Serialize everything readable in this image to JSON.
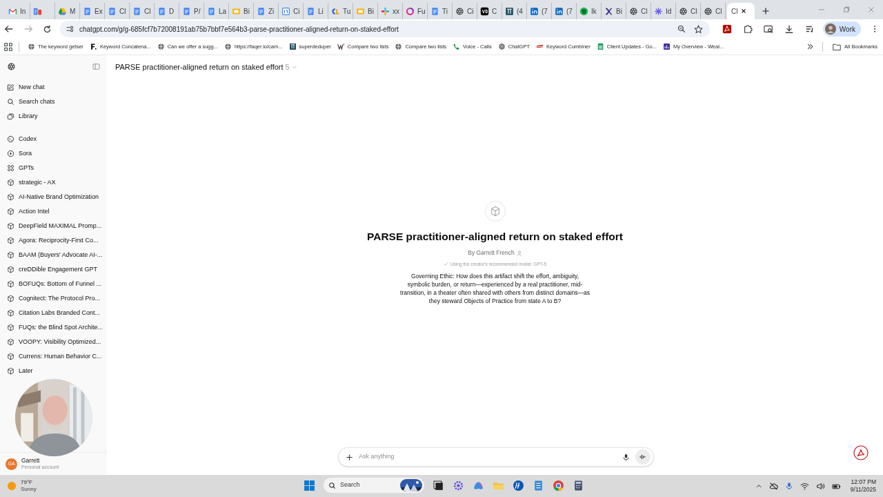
{
  "tabs": [
    {
      "kind": "gmail",
      "label": "In",
      "selected": false
    },
    {
      "kind": "docs-pair",
      "selected": false
    },
    {
      "kind": "drive",
      "label": "M",
      "selected": false
    },
    {
      "kind": "docs",
      "label": "Ex",
      "selected": false
    },
    {
      "kind": "docs",
      "label": "Cl",
      "selected": false
    },
    {
      "kind": "docs",
      "label": "Cl",
      "selected": false
    },
    {
      "kind": "docs",
      "label": "D",
      "selected": false
    },
    {
      "kind": "docs",
      "label": "P/",
      "selected": false
    },
    {
      "kind": "docs",
      "label": "La",
      "selected": false
    },
    {
      "kind": "slides",
      "label": "Bi",
      "selected": false
    },
    {
      "kind": "docs",
      "label": "Zi",
      "selected": false
    },
    {
      "kind": "calendar",
      "label": "Ci",
      "selected": false
    },
    {
      "kind": "docs",
      "label": "Li",
      "selected": false
    },
    {
      "kind": "cl",
      "label": "Tu",
      "selected": false
    },
    {
      "kind": "slides",
      "label": "Bi",
      "selected": false
    },
    {
      "kind": "slack",
      "label": "xx",
      "selected": false
    },
    {
      "kind": "ring",
      "label": "Fu",
      "selected": false
    },
    {
      "kind": "docs",
      "label": "Ti",
      "selected": false
    },
    {
      "kind": "openai",
      "label": "Ci",
      "selected": false
    },
    {
      "kind": "vo",
      "label": "C",
      "selected": false
    },
    {
      "kind": "tt",
      "label": "(4",
      "selected": false
    },
    {
      "kind": "linkedin",
      "label": "(7",
      "selected": false
    },
    {
      "kind": "linkedin",
      "label": "(7",
      "selected": false
    },
    {
      "kind": "spotify",
      "label": "Ik",
      "selected": false
    },
    {
      "kind": "x",
      "label": "Bi",
      "selected": false
    },
    {
      "kind": "openai",
      "label": "Cl",
      "selected": false
    },
    {
      "kind": "star",
      "label": "Id",
      "selected": false
    },
    {
      "kind": "openai",
      "label": "Cl",
      "selected": false
    },
    {
      "kind": "openai",
      "label": "Cl",
      "selected": false
    },
    {
      "kind": "plain",
      "label": "Cl",
      "selected": true
    }
  ],
  "address_bar": {
    "url": "chatgpt.com/g/g-685fcf7b72008191ab75b7bbf7e564b3-parse-practitioner-aligned-return-on-staked-effort"
  },
  "profile": {
    "label": "Work"
  },
  "bookmarks": [
    {
      "kind": "globe",
      "label": "The keyword getser"
    },
    {
      "kind": "f",
      "label": "Keyword Concatena..."
    },
    {
      "kind": "globe",
      "label": "Can we offer a sugg..."
    },
    {
      "kind": "globe",
      "label": "https://faqer.io/cam..."
    },
    {
      "kind": "tt",
      "label": "superdeduper"
    },
    {
      "kind": "w",
      "label": "Compare two lists"
    },
    {
      "kind": "globe",
      "label": "Compare two lists"
    },
    {
      "kind": "phone",
      "label": "Voice - Calls"
    },
    {
      "kind": "openai",
      "label": "ChatGPT"
    },
    {
      "kind": "flag",
      "label": "Keyword Combiner"
    },
    {
      "kind": "sheets",
      "label": "Client Updates - Go..."
    },
    {
      "kind": "chart",
      "label": "My Overview - Weal..."
    }
  ],
  "all_bookmarks": "All Bookmarks",
  "sidebar": {
    "nav": [
      {
        "kind": "edit",
        "label": "New chat"
      },
      {
        "kind": "search",
        "label": "Search chats"
      },
      {
        "kind": "library",
        "label": "Library"
      }
    ],
    "apps": [
      {
        "kind": "codex",
        "label": "Codex"
      },
      {
        "kind": "play",
        "label": "Sora"
      },
      {
        "kind": "grid",
        "label": "GPTs"
      }
    ],
    "gpts": [
      "strategic - AX",
      "AI-Native Brand Optimization",
      "Action Intel",
      "DeepField MAXIMAL Promp...",
      "Agora: Reciprocity-First Co...",
      "BAAM (Buyers' Advocate AI-...",
      "creDDible Engagement GPT",
      "BOFUQs: Bottom of Funnel ...",
      "Cognitect: The Protocol Pro...",
      "Citation Labs Branded Cont...",
      "FUQs: the Blind Spot Archite...",
      "VOOPY: Visibility Optimized...",
      "Currens: Human Behavior C...",
      "Later"
    ],
    "account": {
      "initials": "GA",
      "name": "Garrett",
      "plan": "Personal account"
    }
  },
  "header": {
    "title": "PARSE practitioner-aligned return on staked effort",
    "version": "5"
  },
  "gpt": {
    "title": "PARSE practitioner-aligned return on staked effort",
    "author": "By Garrett French",
    "model_note": "Using the creator's recommended model: GPT-5",
    "description": "Governing Ethic: How does this artifact shift the effort, ambiguity, symbolic burden, or return—experienced by a real practitioner, mid-transition, in a theater often shared with others from distinct domains—as they steward Objects of Practice from state A to B?"
  },
  "composer": {
    "placeholder": "Ask anything"
  },
  "taskbar": {
    "weather": {
      "temp": "79°F",
      "condition": "Sunny"
    },
    "search": {
      "placeholder": "Search"
    },
    "apps": [
      {
        "kind": "squares"
      },
      {
        "kind": "gear"
      },
      {
        "kind": "copilot"
      },
      {
        "kind": "folder"
      },
      {
        "kind": "hp"
      },
      {
        "kind": "notepad"
      },
      {
        "kind": "chrome"
      },
      {
        "kind": "calculator"
      }
    ],
    "time": "12:07 PM",
    "date": "9/11/2025"
  }
}
